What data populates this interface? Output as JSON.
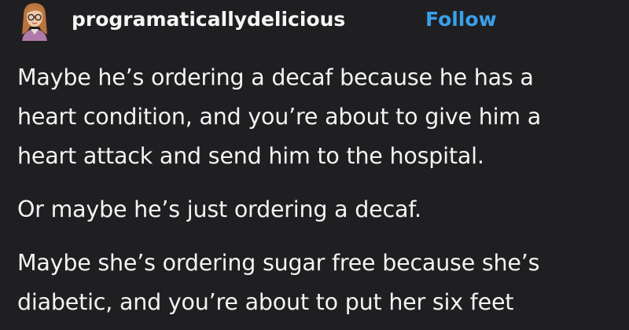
{
  "post": {
    "author": "programaticallydelicious",
    "follow_label": "Follow",
    "avatar_icon": "avatar-illustration-icon",
    "paragraphs": [
      {
        "lines": [
          "Maybe he’s ordering a decaf because he has a",
          "heart condition, and you’re about to give him a",
          "heart attack and send him to the hospital."
        ]
      },
      {
        "lines": [
          "Or maybe he’s just ordering a decaf."
        ]
      },
      {
        "lines": [
          "Maybe she’s ordering sugar free because she’s",
          "diabetic, and you’re about to put her six feet"
        ]
      }
    ]
  },
  "colors": {
    "background": "#1f1f22",
    "text": "#f3f3f3",
    "follow_accent": "#3aa0e8"
  }
}
